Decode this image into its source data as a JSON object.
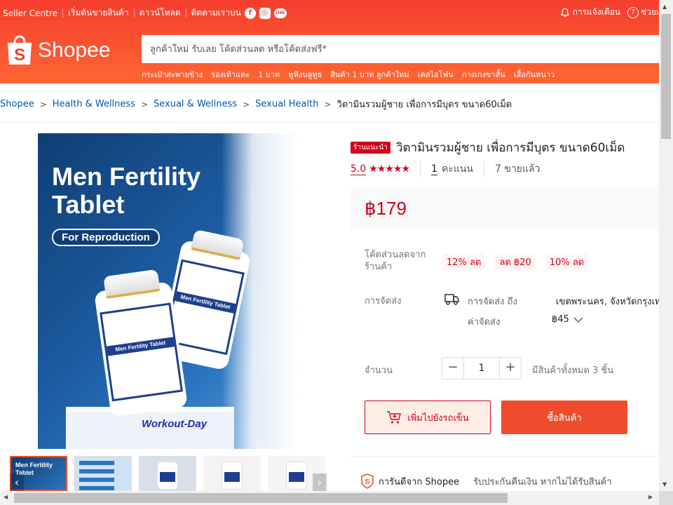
{
  "topbar": {
    "links": [
      "Seller Centre",
      "เริ่มต้นขายสินค้า",
      "ดาวน์โหลด",
      "ติดตามเราบน"
    ],
    "social": [
      "f",
      "◎",
      "LINE"
    ],
    "notifications": "การแจ้งเตือน",
    "help": "ช่วยเ"
  },
  "brand": {
    "logo_text": "Shopee",
    "color": "#ee4d2d"
  },
  "search": {
    "placeholder": "ลูกค้าใหม่ รับเลย โค้ดส่วนลด หรือโค้ดส่งฟรี*"
  },
  "suggestions": [
    "กระเป๋าสะพายข้าง",
    "รองเท้าแตะ",
    "1 บาท",
    "หูฟังบลูทูธ",
    "สินค้า 1 บาท ลูกค้าใหม่",
    "เคสไอโฟน",
    "กางเกงขาสั้น",
    "เสื้อกันหนาว"
  ],
  "breadcrumb": [
    "Shopee",
    "Health & Wellness",
    "Sexual & Wellness",
    "Sexual Health",
    "วิตามินรวมผู้ชาย เพื่อการมีบุตร ขนาด60เม็ด"
  ],
  "gallery": {
    "image_title_line1": "Men Fertility",
    "image_title_line2": "Tablet",
    "image_pill": "For Reproduction",
    "bottle_label": "Men Fertility Tablet",
    "brand_watermark": "Workout-Day",
    "thumb1_text": "Men Fertility Tablet",
    "prev_arrow": "‹",
    "next_arrow": "›"
  },
  "product": {
    "badge": "ร้านแนะนำ",
    "title": "วิตามินรวมผู้ชาย เพื่อการมีบุตร ขนาด60เม็ด",
    "rating": "5.0",
    "stars": "★★★★★",
    "ratings_count": "1",
    "ratings_label": "คะแนน",
    "sold": "7 ขายแล้ว",
    "price": "฿179"
  },
  "vouchers": {
    "label": "โค้ดส่วนลดจากร้านค้า",
    "items": [
      "12% ลด",
      "ลด ฿20",
      "10% ลด"
    ]
  },
  "shipping": {
    "label": "การจัดส่ง",
    "to_label": "การจัดส่ง ถึง",
    "destination": "เขตพระนคร, จังหวัดกรุงเท",
    "fee_label": "ค่าจัดส่ง",
    "fee": "฿45"
  },
  "quantity": {
    "label": "จำนวน",
    "minus": "−",
    "value": "1",
    "plus": "+",
    "stock": "มีสินค้าทั้งหมด 3 ชิ้น"
  },
  "actions": {
    "add_to_cart": "เพิ่มไปยังรถเข็น",
    "buy_now": "ซื้อสินค้า"
  },
  "guarantee": {
    "title": "การันตีจาก Shopee",
    "desc": "รับประกันคืนเงิน หากไม่ได้รับสินค้า"
  },
  "scroll": {
    "up": "▲",
    "down": "▼",
    "left": "◀",
    "right": "▶"
  }
}
